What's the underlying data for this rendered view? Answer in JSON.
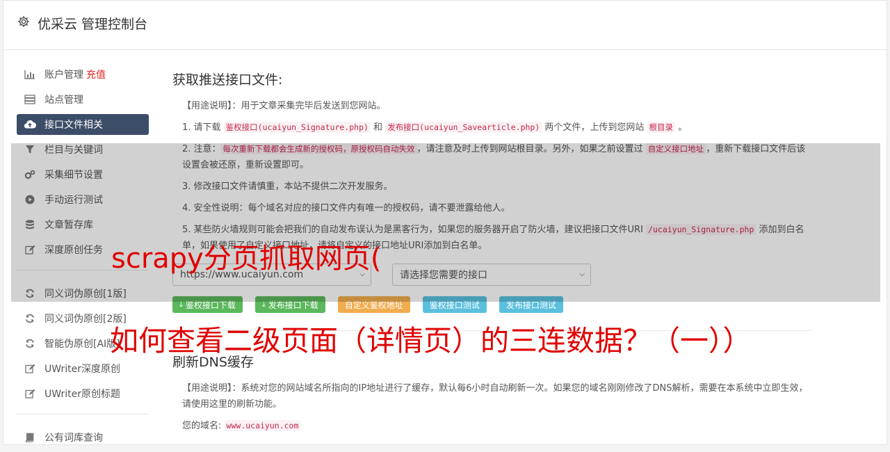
{
  "app": {
    "title": "优采云 管理控制台"
  },
  "sidebar": {
    "items": [
      {
        "label": "账户管理",
        "extra": "充值"
      },
      {
        "label": "站点管理"
      },
      {
        "label": "接口文件相关"
      },
      {
        "label": "栏目与关键词"
      },
      {
        "label": "采集细节设置"
      },
      {
        "label": "手动运行测试"
      },
      {
        "label": "文章暂存库"
      },
      {
        "label": "深度原创任务"
      },
      {
        "label": "同义词伪原创[1版]"
      },
      {
        "label": "同义词伪原创[2版]"
      },
      {
        "label": "智能伪原创[AI版]"
      },
      {
        "label": "UWriter深度原创"
      },
      {
        "label": "UWriter原创标题"
      },
      {
        "label": "公有词库查询"
      }
    ]
  },
  "main": {
    "heading": "获取推送接口文件:",
    "usage_label": "【用途说明】",
    "usage_text": "：用于文章采集完毕后发送到您网站。",
    "step1": {
      "prefix": "1. 请下载 ",
      "code1": "鉴权接口(ucaiyun_Signature.php)",
      "mid": " 和 ",
      "code2": "发布接口(ucaiyun_Savearticle.php)",
      "mid2": " 两个文件，上传到您网站 ",
      "code3": "根目录",
      "suffix": " 。"
    },
    "step2": {
      "prefix": "2. 注意：",
      "code1": "每次重新下载都会生成新的授权码，原授权码自动失效",
      "mid": "，请注意及时上传到网站根目录。另外，如果之前设置过 ",
      "code2": "自定义接口地址",
      "suffix": "，重新下载接口文件后该设置会被还原，重新设置即可。"
    },
    "step3": "3. 修改接口文件请慎重，本站不提供二次开发服务。",
    "step4": "4. 安全性说明：每个域名对应的接口文件内有唯一的授权码，请不要泄露给他人。",
    "step5": {
      "prefix": "5. 某些防火墙规则可能会把我们的自动发布误认为是黑客行为，如果您的服务器开启了防火墙，建议把接口文件URI ",
      "code1": "/ucaiyun_Signature.php",
      "suffix": " 添加到白名单，如果使用了自定义接口地址，请将自定义的接口地址URI添加到白名单。"
    },
    "site_select": "https://www.ucaiyun.com",
    "api_select": "请选择您需要的接口",
    "buttons": {
      "download_auth": "鉴权接口下载",
      "download_publish": "发布接口下载",
      "custom_auth_url": "自定义鉴权地址",
      "test_auth": "鉴权接口测试",
      "test_publish": "发布接口测试"
    },
    "dns_heading": "刷新DNS缓存",
    "dns_usage_label": "【用途说明】",
    "dns_usage_text": "：系统对您的网站域名所指向的IP地址进行了缓存，默认每6小时自动刷新一次。如果您的域名刚刚修改了DNS解析，需要在本系统中立即生效，请使用这里的刷新功能。",
    "domain_label": "您的域名:",
    "domain_value": "www.ucaiyun.com"
  },
  "overlay": {
    "caption1": "scrapy分页抓取网页(",
    "caption2": "如何查看二级页面（详情页）的三连数据？（一））"
  },
  "colors": {
    "nav_active": "#3c4d68",
    "btn_green": "#5cb85c",
    "btn_orange": "#f0ad4e",
    "btn_blue": "#5bc0de",
    "caption_red": "#e00000"
  }
}
